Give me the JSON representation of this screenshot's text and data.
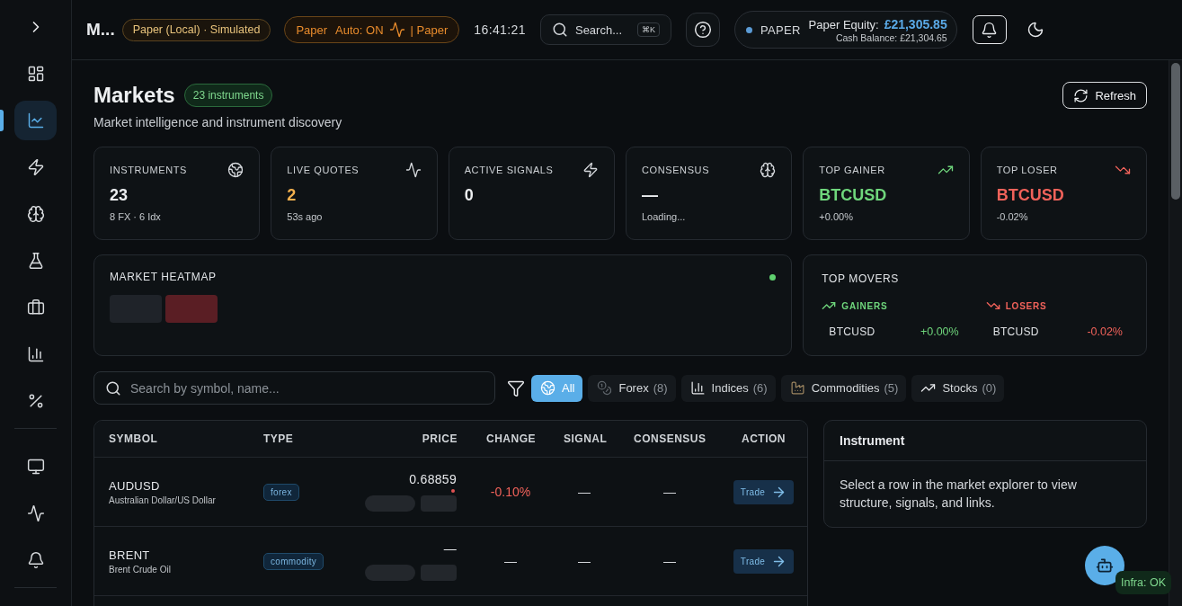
{
  "sidebar": {
    "groups": [
      {
        "items": [
          {
            "selected": false
          },
          {
            "selected": true
          },
          {
            "selected": false
          },
          {
            "selected": false
          },
          {
            "selected": false
          },
          {
            "selected": false
          },
          {
            "selected": false
          },
          {
            "selected": false
          }
        ]
      },
      {
        "items": [
          {
            "selected": false
          },
          {
            "selected": false
          },
          {
            "selected": false
          }
        ]
      }
    ]
  },
  "topbar": {
    "title": "M...",
    "environment_badge": "Paper (Local) · Simulated",
    "mode_badge": {
      "mode": "Paper",
      "auto": "Auto: ON",
      "suffix": "| Paper"
    },
    "clock": "16:41:21",
    "search": {
      "label": "Search...",
      "shortcut": "⌘K"
    },
    "account": {
      "mode": "PAPER",
      "equity_label": "Paper Equity:",
      "equity": "£21,305.85",
      "cash_balance": "Cash Balance: £21,304.65"
    }
  },
  "page": {
    "title": "Markets",
    "count_badge": "23 instruments",
    "subtitle": "Market intelligence and instrument discovery",
    "refresh_button": "Refresh"
  },
  "stats": [
    {
      "label": "INSTRUMENTS",
      "value": "23",
      "sub": "8 FX · 6 Idx",
      "color": "#eceef0"
    },
    {
      "label": "LIVE QUOTES",
      "value": "2",
      "sub": "53s ago",
      "color": "#f2b04e"
    },
    {
      "label": "ACTIVE SIGNALS",
      "value": "0",
      "color": "#eceef0"
    },
    {
      "label": "CONSENSUS",
      "value": "—",
      "sub": "Loading...",
      "color": "#eceef0"
    },
    {
      "label": "TOP GAINER",
      "value": "BTCUSD",
      "sub": "+0.00%",
      "color": "#6fd67c"
    },
    {
      "label": "TOP LOSER",
      "value": "BTCUSD",
      "sub": "-0.02%",
      "color": "#f0625a"
    }
  ],
  "heatmap": {
    "title": "MARKET HEATMAP",
    "live": true,
    "tiles": [
      {
        "color": "#1f2329"
      },
      {
        "color": "#5a1e24"
      }
    ]
  },
  "top_movers": {
    "title": "TOP MOVERS",
    "columns": [
      {
        "kind": "gainers",
        "label": "GAINERS",
        "rows": [
          {
            "symbol": "BTCUSD",
            "change": "+0.00%"
          }
        ]
      },
      {
        "kind": "losers",
        "label": "LOSERS",
        "rows": [
          {
            "symbol": "BTCUSD",
            "change": "-0.02%"
          }
        ]
      }
    ]
  },
  "filters": {
    "search_placeholder": "Search by symbol, name...",
    "chips": [
      {
        "label": "All",
        "selected": true
      },
      {
        "label": "Forex",
        "count": "(8)",
        "selected": false
      },
      {
        "label": "Indices",
        "count": "(6)",
        "selected": false
      },
      {
        "label": "Commodities",
        "count": "(5)",
        "selected": false
      },
      {
        "label": "Stocks",
        "count": "(0)",
        "selected": false
      }
    ]
  },
  "table": {
    "columns": [
      "SYMBOL",
      "TYPE",
      "PRICE",
      "CHANGE",
      "SIGNAL",
      "CONSENSUS",
      "ACTION"
    ],
    "rows": [
      {
        "symbol": "AUDUSD",
        "name": "Australian Dollar/US Dollar",
        "type": "forex",
        "price": "0.68859",
        "price_marker": true,
        "loading": true,
        "change": {
          "text": "-0.10%",
          "color": "#f0625a"
        },
        "signal": "—",
        "consensus": "—",
        "action": "Trade"
      },
      {
        "symbol": "BRENT",
        "name": "Brent Crude Oil",
        "type": "commodity",
        "price": "—",
        "price_marker": false,
        "loading": true,
        "change": {
          "text": "—",
          "color": "#d3d6da"
        },
        "signal": "—",
        "consensus": "—",
        "action": "Trade"
      }
    ]
  },
  "instrument_panel": {
    "title": "Instrument",
    "message": "Select a row in the market explorer to view structure, signals, and links."
  },
  "status_badge": {
    "label": "Infra: OK"
  }
}
